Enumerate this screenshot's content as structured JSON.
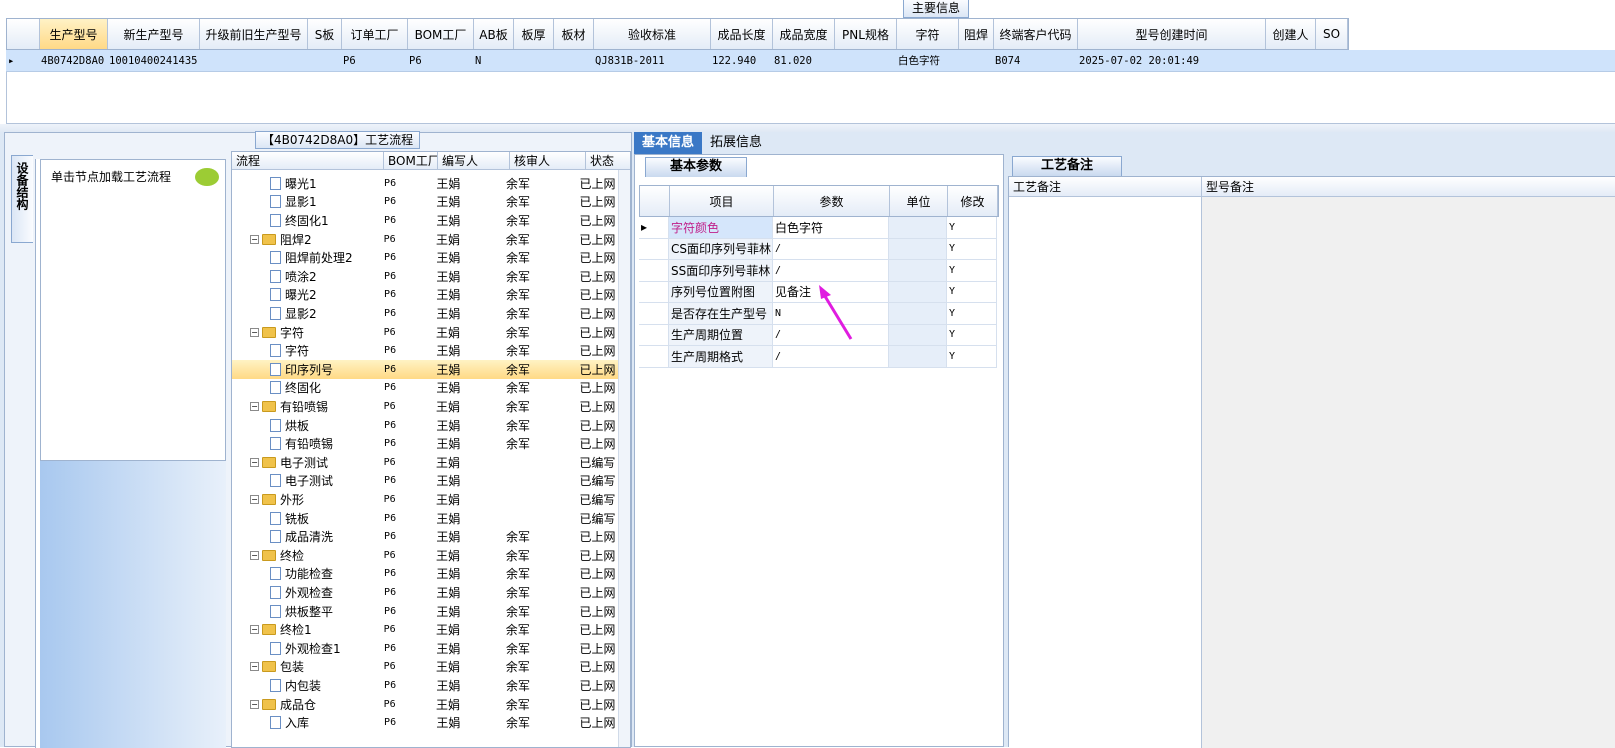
{
  "top_tab": {
    "label": "主要信息"
  },
  "main_grid": {
    "columns": [
      "生产型号",
      "新生产型号",
      "升级前旧生产型号",
      "S板",
      "订单工厂",
      "BOM工厂",
      "AB板",
      "板厚",
      "板材",
      "验收标准",
      "成品长度",
      "成品宽度",
      "PNL规格",
      "字符",
      "阻焊",
      "终端客户代码",
      "型号创建时间",
      "创建人",
      "SO"
    ],
    "row": {
      "row_marker": "▸",
      "cells": [
        "4B0742D8A0",
        "10010400241435",
        "",
        "",
        "P6",
        "P6",
        "N",
        "",
        "",
        "QJ831B-2011",
        "122.940",
        "81.020",
        "",
        "白色字符",
        "",
        "B074",
        "2025-07-02 20:01:49",
        "",
        ""
      ]
    }
  },
  "flow": {
    "title": "【4B0742D8A0】工艺流程",
    "side_tab": "设备结构",
    "side_item": "单击节点加载工艺流程",
    "columns": [
      "流程",
      "BOM工厂",
      "编写人",
      "核审人",
      "状态"
    ],
    "rows": [
      {
        "indent": 2,
        "type": "doc",
        "name": "曝光1",
        "bom": "P6",
        "writer": "王娟",
        "reviewer": "余军",
        "status": "已上网"
      },
      {
        "indent": 2,
        "type": "doc",
        "name": "显影1",
        "bom": "P6",
        "writer": "王娟",
        "reviewer": "余军",
        "status": "已上网"
      },
      {
        "indent": 2,
        "type": "doc",
        "name": "终固化1",
        "bom": "P6",
        "writer": "王娟",
        "reviewer": "余军",
        "status": "已上网"
      },
      {
        "indent": 1,
        "type": "folder",
        "name": "阻焊2",
        "bom": "P6",
        "writer": "王娟",
        "reviewer": "余军",
        "status": "已上网"
      },
      {
        "indent": 2,
        "type": "doc",
        "name": "阻焊前处理2",
        "bom": "P6",
        "writer": "王娟",
        "reviewer": "余军",
        "status": "已上网"
      },
      {
        "indent": 2,
        "type": "doc",
        "name": "喷涂2",
        "bom": "P6",
        "writer": "王娟",
        "reviewer": "余军",
        "status": "已上网"
      },
      {
        "indent": 2,
        "type": "doc",
        "name": "曝光2",
        "bom": "P6",
        "writer": "王娟",
        "reviewer": "余军",
        "status": "已上网"
      },
      {
        "indent": 2,
        "type": "doc",
        "name": "显影2",
        "bom": "P6",
        "writer": "王娟",
        "reviewer": "余军",
        "status": "已上网"
      },
      {
        "indent": 1,
        "type": "folder",
        "name": "字符",
        "bom": "P6",
        "writer": "王娟",
        "reviewer": "余军",
        "status": "已上网"
      },
      {
        "indent": 2,
        "type": "doc",
        "name": "字符",
        "bom": "P6",
        "writer": "王娟",
        "reviewer": "余军",
        "status": "已上网"
      },
      {
        "indent": 2,
        "type": "doc",
        "name": "印序列号",
        "bom": "P6",
        "writer": "王娟",
        "reviewer": "余军",
        "status": "已上网",
        "highlight": true
      },
      {
        "indent": 2,
        "type": "doc",
        "name": "终固化",
        "bom": "P6",
        "writer": "王娟",
        "reviewer": "余军",
        "status": "已上网"
      },
      {
        "indent": 1,
        "type": "folder",
        "name": "有铅喷锡",
        "bom": "P6",
        "writer": "王娟",
        "reviewer": "余军",
        "status": "已上网"
      },
      {
        "indent": 2,
        "type": "doc",
        "name": "烘板",
        "bom": "P6",
        "writer": "王娟",
        "reviewer": "余军",
        "status": "已上网"
      },
      {
        "indent": 2,
        "type": "doc",
        "name": "有铅喷锡",
        "bom": "P6",
        "writer": "王娟",
        "reviewer": "余军",
        "status": "已上网"
      },
      {
        "indent": 1,
        "type": "folder",
        "name": "电子测试",
        "bom": "P6",
        "writer": "王娟",
        "reviewer": "",
        "status": "已编写"
      },
      {
        "indent": 2,
        "type": "doc",
        "name": "电子测试",
        "bom": "P6",
        "writer": "王娟",
        "reviewer": "",
        "status": "已编写"
      },
      {
        "indent": 1,
        "type": "folder",
        "name": "外形",
        "bom": "P6",
        "writer": "王娟",
        "reviewer": "",
        "status": "已编写"
      },
      {
        "indent": 2,
        "type": "doc",
        "name": "铣板",
        "bom": "P6",
        "writer": "王娟",
        "reviewer": "",
        "status": "已编写"
      },
      {
        "indent": 2,
        "type": "doc",
        "name": "成品清洗",
        "bom": "P6",
        "writer": "王娟",
        "reviewer": "余军",
        "status": "已上网"
      },
      {
        "indent": 1,
        "type": "folder",
        "name": "终检",
        "bom": "P6",
        "writer": "王娟",
        "reviewer": "余军",
        "status": "已上网"
      },
      {
        "indent": 2,
        "type": "doc",
        "name": "功能检查",
        "bom": "P6",
        "writer": "王娟",
        "reviewer": "余军",
        "status": "已上网"
      },
      {
        "indent": 2,
        "type": "doc",
        "name": "外观检查",
        "bom": "P6",
        "writer": "王娟",
        "reviewer": "余军",
        "status": "已上网"
      },
      {
        "indent": 2,
        "type": "doc",
        "name": "烘板整平",
        "bom": "P6",
        "writer": "王娟",
        "reviewer": "余军",
        "status": "已上网"
      },
      {
        "indent": 1,
        "type": "folder",
        "name": "终检1",
        "bom": "P6",
        "writer": "王娟",
        "reviewer": "余军",
        "status": "已上网"
      },
      {
        "indent": 2,
        "type": "doc",
        "name": "外观检查1",
        "bom": "P6",
        "writer": "王娟",
        "reviewer": "余军",
        "status": "已上网"
      },
      {
        "indent": 1,
        "type": "folder",
        "name": "包装",
        "bom": "P6",
        "writer": "王娟",
        "reviewer": "余军",
        "status": "已上网"
      },
      {
        "indent": 2,
        "type": "doc",
        "name": "内包装",
        "bom": "P6",
        "writer": "王娟",
        "reviewer": "余军",
        "status": "已上网"
      },
      {
        "indent": 1,
        "type": "folder",
        "name": "成品仓",
        "bom": "P6",
        "writer": "王娟",
        "reviewer": "余军",
        "status": "已上网"
      },
      {
        "indent": 2,
        "type": "doc",
        "name": "入库",
        "bom": "P6",
        "writer": "王娟",
        "reviewer": "余军",
        "status": "已上网"
      }
    ]
  },
  "detail": {
    "tabs": [
      "基本信息",
      "拓展信息"
    ],
    "sub_tab": "基本参数",
    "columns": [
      "项目",
      "参数",
      "单位",
      "修改"
    ],
    "rows": [
      {
        "item": "字符颜色",
        "value": "白色字符",
        "unit": "",
        "modify": "Y",
        "selected": true
      },
      {
        "item": "CS面印序列号菲林",
        "value": "/",
        "unit": "",
        "modify": "Y"
      },
      {
        "item": "SS面印序列号菲林",
        "value": "/",
        "unit": "",
        "modify": "Y"
      },
      {
        "item": "序列号位置附图",
        "value": "见备注",
        "unit": "",
        "modify": "Y"
      },
      {
        "item": "是否存在生产型号",
        "value": "N",
        "unit": "",
        "modify": "Y"
      },
      {
        "item": "生产周期位置",
        "value": "/",
        "unit": "",
        "modify": "Y"
      },
      {
        "item": "生产周期格式",
        "value": "/",
        "unit": "",
        "modify": "Y"
      }
    ]
  },
  "notes": {
    "tab": "工艺备注",
    "columns": [
      "工艺备注",
      "型号备注"
    ]
  },
  "colors": {
    "selected_row": "#cfe3fb",
    "highlight": "#ffd985",
    "accent": "#3a78c6",
    "annotation_arrow": "#e01ce0",
    "selected_item_text": "#c0208a"
  }
}
